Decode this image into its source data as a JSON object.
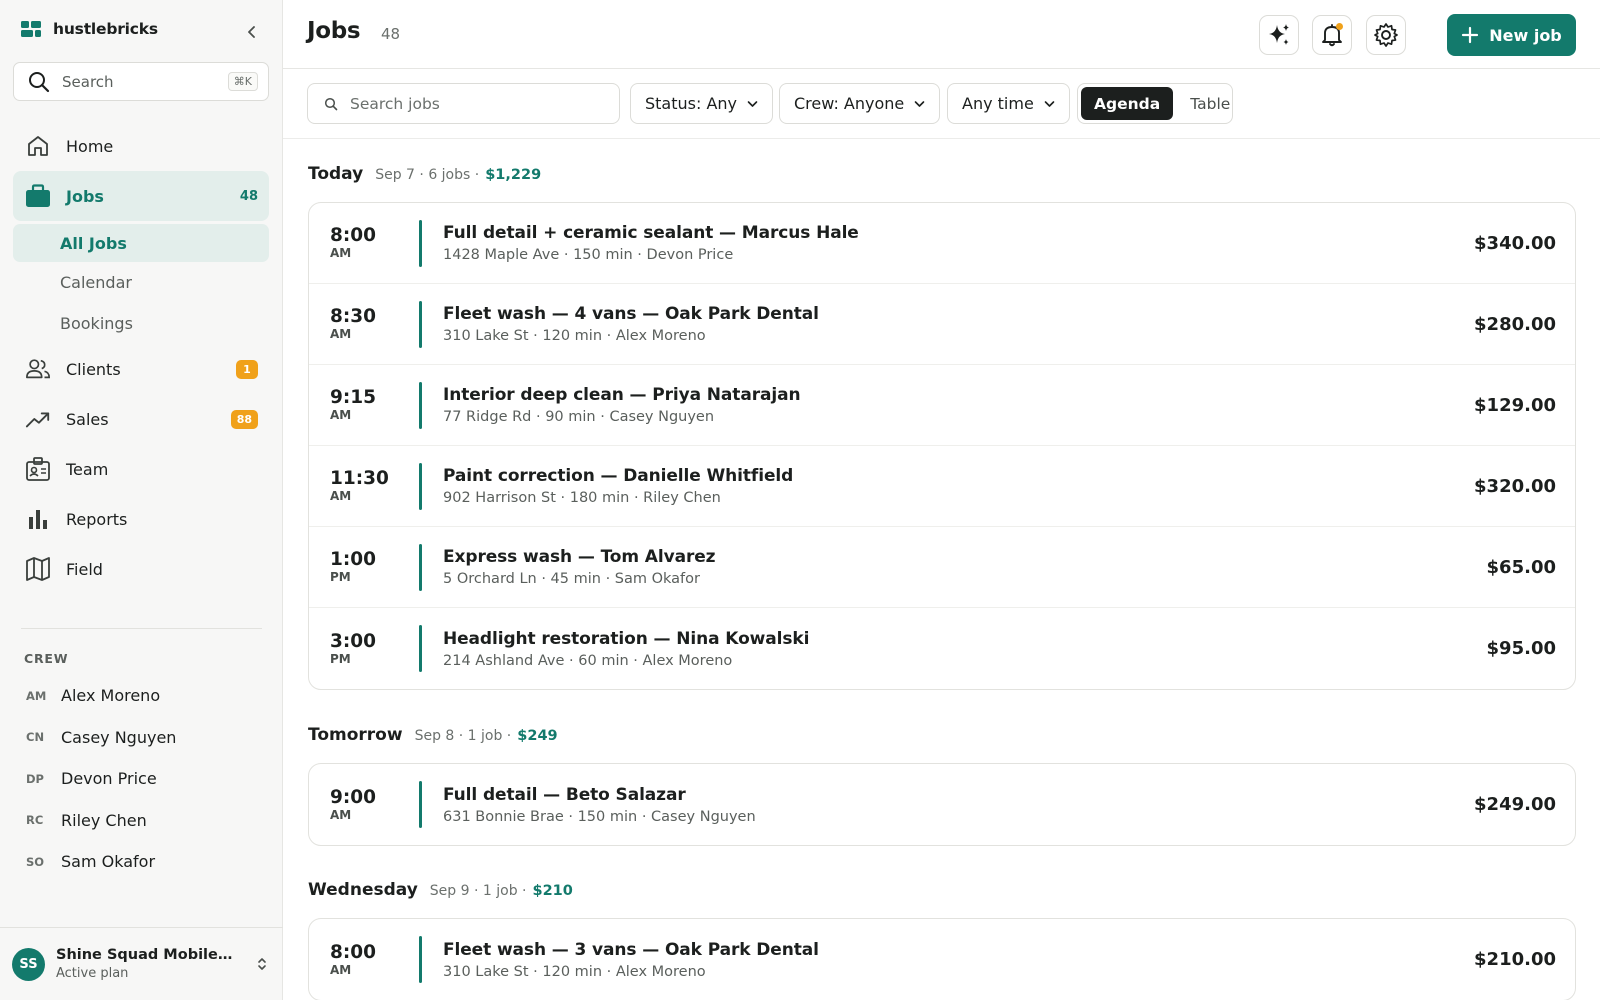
{
  "brand": {
    "name": "hustlebricks",
    "color": "#137a6c"
  },
  "sidebar": {
    "search": {
      "placeholder": "Search",
      "shortcut": "⌘K"
    },
    "nav": [
      {
        "label": "Home",
        "icon": "home-icon"
      },
      {
        "label": "Jobs",
        "icon": "briefcase-icon",
        "count": "48",
        "active": true
      },
      {
        "label": "Clients",
        "icon": "users-icon",
        "badge": "1"
      },
      {
        "label": "Sales",
        "icon": "trending-up-icon",
        "badge": "88"
      },
      {
        "label": "Team",
        "icon": "id-card-icon"
      },
      {
        "label": "Reports",
        "icon": "bar-chart-icon"
      },
      {
        "label": "Field",
        "icon": "map-icon"
      }
    ],
    "jobs_sub": [
      {
        "label": "All Jobs",
        "active": true
      },
      {
        "label": "Calendar"
      },
      {
        "label": "Bookings"
      }
    ],
    "crew_title": "CREW",
    "crew": [
      {
        "initials": "AM",
        "name": "Alex Moreno"
      },
      {
        "initials": "CN",
        "name": "Casey Nguyen"
      },
      {
        "initials": "DP",
        "name": "Devon Price"
      },
      {
        "initials": "RC",
        "name": "Riley Chen"
      },
      {
        "initials": "SO",
        "name": "Sam Okafor"
      }
    ],
    "account": {
      "initials": "SS",
      "name": "Shine Squad Mobile Det...",
      "plan": "Active plan"
    }
  },
  "header": {
    "title": "Jobs",
    "count": "48",
    "new_job_label": "New job",
    "accent": "#137a6c",
    "notif_dot_color": "#f0a11a"
  },
  "toolbar": {
    "search_placeholder": "Search jobs",
    "status_filter": "Status: Any",
    "crew_filter": "Crew: Anyone",
    "time_filter": "Any time",
    "views": [
      "Agenda",
      "Table"
    ],
    "active_view": "Agenda"
  },
  "days": [
    {
      "name": "Today",
      "meta": "Sep 7 · 6 jobs ·",
      "total": "$1,229",
      "jobs": [
        {
          "time": "8:00",
          "ampm": "AM",
          "service": "Full detail + ceramic sealant",
          "client": "Marcus Hale",
          "details": "1428 Maple Ave · 150 min · Devon Price",
          "amount": "$340.00"
        },
        {
          "time": "8:30",
          "ampm": "AM",
          "service": "Fleet wash — 4 vans",
          "client": "Oak Park Dental",
          "details": "310 Lake St · 120 min · Alex Moreno",
          "amount": "$280.00"
        },
        {
          "time": "9:15",
          "ampm": "AM",
          "service": "Interior deep clean",
          "client": "Priya Natarajan",
          "details": "77 Ridge Rd · 90 min · Casey Nguyen",
          "amount": "$129.00"
        },
        {
          "time": "11:30",
          "ampm": "AM",
          "service": "Paint correction",
          "client": "Danielle Whitfield",
          "details": "902 Harrison St · 180 min · Riley Chen",
          "amount": "$320.00"
        },
        {
          "time": "1:00",
          "ampm": "PM",
          "service": "Express wash",
          "client": "Tom Alvarez",
          "details": "5 Orchard Ln · 45 min · Sam Okafor",
          "amount": "$65.00"
        },
        {
          "time": "3:00",
          "ampm": "PM",
          "service": "Headlight restoration",
          "client": "Nina Kowalski",
          "details": "214 Ashland Ave · 60 min · Alex Moreno",
          "amount": "$95.00"
        }
      ]
    },
    {
      "name": "Tomorrow",
      "meta": "Sep 8 · 1 job ·",
      "total": "$249",
      "jobs": [
        {
          "time": "9:00",
          "ampm": "AM",
          "service": "Full detail",
          "client": "Beto Salazar",
          "details": "631 Bonnie Brae · 150 min · Casey Nguyen",
          "amount": "$249.00"
        }
      ]
    },
    {
      "name": "Wednesday",
      "meta": "Sep 9 · 1 job ·",
      "total": "$210",
      "jobs": [
        {
          "time": "8:00",
          "ampm": "AM",
          "service": "Fleet wash — 3 vans",
          "client": "Oak Park Dental",
          "details": "310 Lake St · 120 min · Alex Moreno",
          "amount": "$210.00"
        }
      ]
    }
  ]
}
